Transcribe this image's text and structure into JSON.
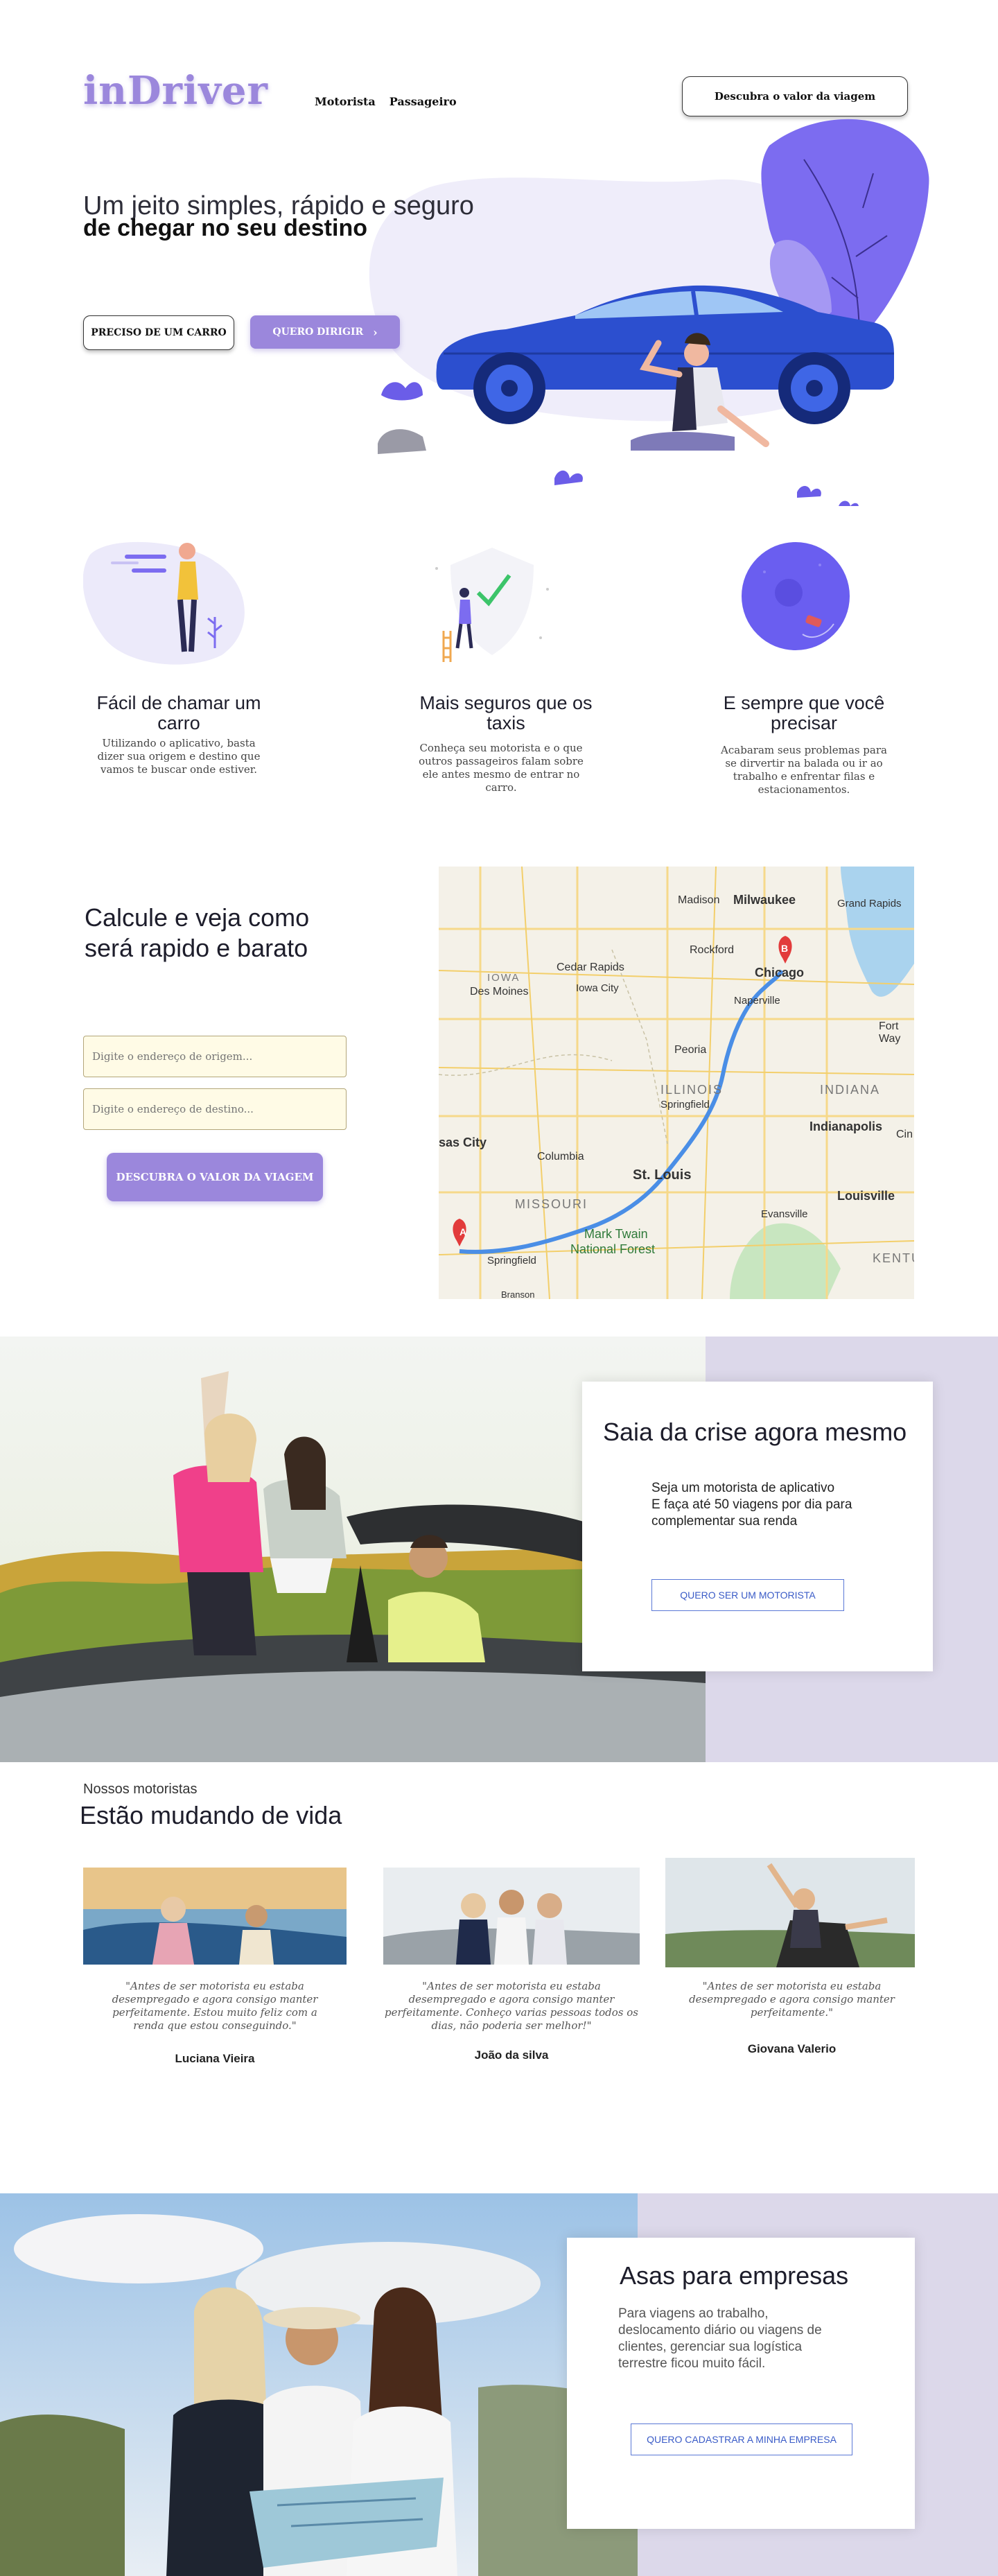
{
  "header": {
    "logo": "inDriver",
    "nav": [
      "Motorista",
      "Passageiro"
    ],
    "cta_label": "Descubra o valor da viagem"
  },
  "hero": {
    "line1": "Um jeito simples, rápido e seguro",
    "line2": "de chegar no seu destino",
    "btn_need_car": "PRECISO DE UM CARRO",
    "btn_drive": "QUERO DIRIGIR",
    "btn_drive_icon": "chevron-right-icon"
  },
  "features": [
    {
      "title": "Fácil de chamar um carro",
      "desc": "Utilizando o aplicativo, basta dizer sua origem e destino que vamos te buscar onde estiver."
    },
    {
      "title": "Mais seguros que os taxis",
      "desc": "Conheça seu motorista e o que outros passageiros falam sobre ele antes mesmo de entrar no carro."
    },
    {
      "title": "E sempre que você precisar",
      "desc": "Acabaram seus problemas para se dirvertir na balada ou ir ao trabalho e enfrentar filas e estacionamentos."
    }
  ],
  "calculator": {
    "title": "Calcule e veja como será rapido e barato",
    "origin_placeholder": "Digite o endereço de origem...",
    "destination_placeholder": "Digite o endereço de destino...",
    "button_label": "DESCUBRA O VALOR DA VIAGEM"
  },
  "map": {
    "labels": [
      "Madison",
      "Milwaukee",
      "Grand Rapids",
      "Rockford",
      "Cedar Rapids",
      "Chicago",
      "IOWA",
      "Des Moines",
      "Iowa City",
      "Naperville",
      "Fort Way",
      "Peoria",
      "ILLINOIS",
      "INDIANA",
      "Springfield",
      "Indianapolis",
      "Cin",
      "sas City",
      "Columbia",
      "St. Louis",
      "Louisville",
      "MISSOURI",
      "Evansville",
      "Mark Twain",
      "National Forest",
      "KENTU",
      "Springfield",
      "Branson"
    ],
    "marker_a": "A",
    "marker_b": "B"
  },
  "promo": {
    "title": "Saia da crise agora mesmo",
    "text_line1": "Seja um motorista de aplicativo",
    "text_line2": "E faça até 50 viagens por dia para complementar sua renda",
    "button_label": "QUERO SER UM MOTORISTA"
  },
  "drivers": {
    "kicker": "Nossos motoristas",
    "title": "Estão mudando de vida",
    "items": [
      {
        "quote": "\"Antes de ser motorista eu estaba desempregado e agora consigo manter perfeitamente. Estou muito feliz com a renda que estou conseguindo.\"",
        "name": "Luciana Vieira"
      },
      {
        "quote": "\"Antes de ser motorista eu estaba desempregado e agora consigo manter perfeitamente. Conheço varias pessoas todos os dias, não poderia ser melhor!\"",
        "name": "João da silva"
      },
      {
        "quote": "\"Antes de ser motorista eu estaba desempregado e agora consigo manter perfeitamente.\"",
        "name": "Giovana Valerio"
      }
    ]
  },
  "business": {
    "title": "Asas para empresas",
    "text": "Para viagens ao trabalho, deslocamento diário ou viagens de clientes, gerenciar sua logística terrestre ficou muito fácil.",
    "button_label": "QUERO CADASTRAR A MINHA EMPRESA"
  },
  "colors": {
    "brand": "#9b87dc",
    "accent_blue": "#3a5bc7",
    "lavender_bg": "#dcd8ea",
    "car_blue": "#2c4fcf"
  }
}
